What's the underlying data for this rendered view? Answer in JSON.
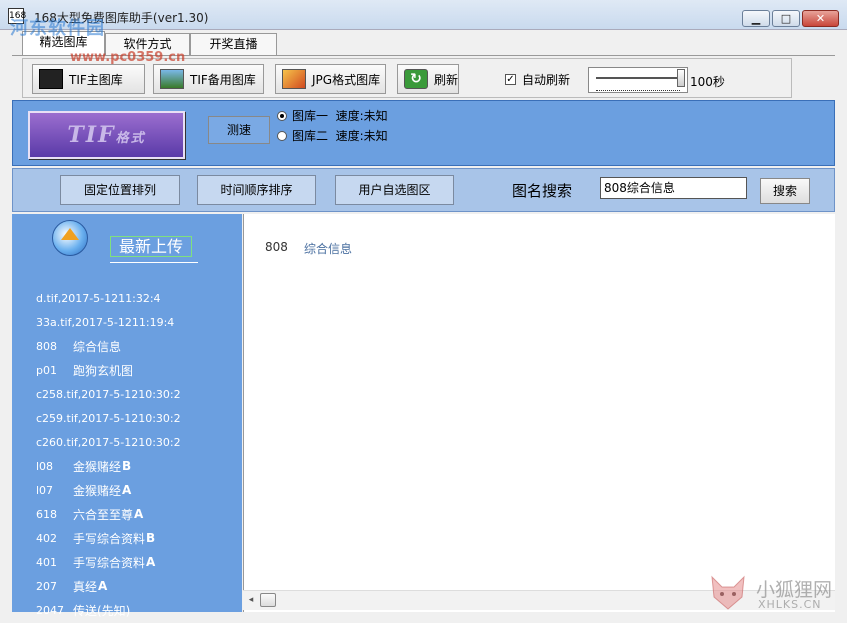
{
  "window": {
    "title": "168大型免费图库助手(ver1.30)",
    "app_icon_label": "168",
    "minimize": "▁",
    "maximize": "□",
    "close": "✕"
  },
  "tabs": [
    {
      "label": "精选图库",
      "active": true
    },
    {
      "label": "软件方式",
      "active": false
    },
    {
      "label": "开奖直播",
      "active": false
    }
  ],
  "toolbar": {
    "tif_main": "TIF主图库",
    "tif_backup": "TIF备用图库",
    "jpg": "JPG格式图库",
    "refresh": "刷新",
    "refresh_glyph": "↻",
    "auto_refresh_label": "自动刷新",
    "auto_refresh_checked": true,
    "auto_refresh_check": "✓",
    "interval": "100秒"
  },
  "banner": {
    "logo_big": "TIF",
    "logo_small": "格式",
    "speed_test": "测速",
    "library_1": "图库一  速度:未知",
    "library_2": "图库二  速度:未知",
    "selected_library": 1
  },
  "filters": {
    "fixed_position": "固定位置排列",
    "time_order": "时间顺序排序",
    "user_selected": "用户自选图区",
    "search_label": "图名搜索",
    "search_value": "808综合信息",
    "search_button": "搜索"
  },
  "sidebar": {
    "title": "最新上传",
    "items": [
      {
        "code": "d.tif,2017-5-1211:32:4",
        "name": "",
        "suffix": ""
      },
      {
        "code": "33a.tif,2017-5-1211:19:4",
        "name": "",
        "suffix": ""
      },
      {
        "code": "808",
        "name": "综合信息",
        "suffix": ""
      },
      {
        "code": "p01",
        "name": "跑狗玄机图",
        "suffix": ""
      },
      {
        "code": "c258.tif,2017-5-1210:30:2",
        "name": "",
        "suffix": ""
      },
      {
        "code": "c259.tif,2017-5-1210:30:2",
        "name": "",
        "suffix": ""
      },
      {
        "code": "c260.tif,2017-5-1210:30:2",
        "name": "",
        "suffix": ""
      },
      {
        "code": "l08",
        "name": "金猴赌经",
        "suffix": "B"
      },
      {
        "code": "l07",
        "name": "金猴赌经",
        "suffix": "A"
      },
      {
        "code": "618",
        "name": "六合至至尊",
        "suffix": "A"
      },
      {
        "code": "402",
        "name": "手写综合资料",
        "suffix": "B"
      },
      {
        "code": "401",
        "name": "手写综合资料",
        "suffix": "A"
      },
      {
        "code": "207",
        "name": "真经",
        "suffix": "A"
      },
      {
        "code": "2047",
        "name": "传送(先知)",
        "suffix": ""
      }
    ]
  },
  "results": {
    "code": "808",
    "name": "综合信息"
  },
  "scrollbar": {
    "left_arrow": "◂"
  },
  "watermarks": {
    "top_site": "河东软件园",
    "top_url": "www.pc0359.cn",
    "bottom_brand": "小狐狸网",
    "bottom_domain": "XHLKS.CN"
  }
}
